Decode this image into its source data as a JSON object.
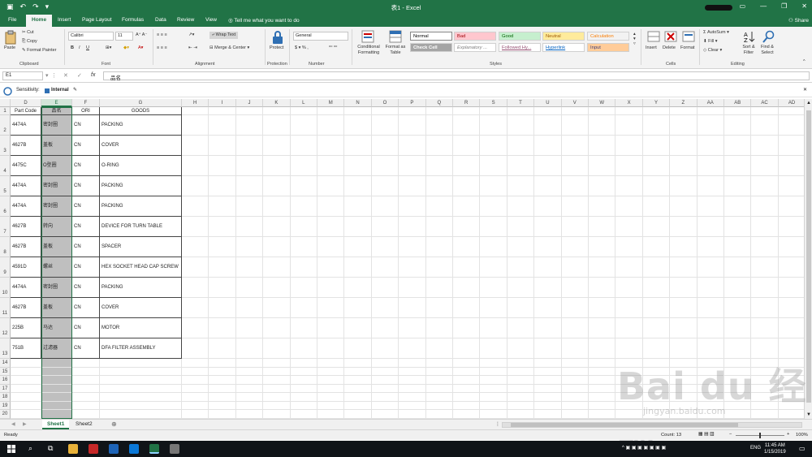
{
  "window": {
    "title": "表1 - Excel"
  },
  "tabs": [
    "File",
    "Home",
    "Insert",
    "Page Layout",
    "Formulas",
    "Data",
    "Review",
    "View"
  ],
  "tellme": "Tell me what you want to do",
  "share": "Share",
  "ribbon": {
    "clipboard": {
      "paste": "Paste",
      "cut": "Cut",
      "copy": "Copy",
      "format_painter": "Format Painter",
      "group": "Clipboard"
    },
    "font": {
      "name": "Calibri",
      "size": "11",
      "group": "Font"
    },
    "alignment": {
      "wrap": "Wrap Text",
      "merge": "Merge & Center",
      "group": "Alignment"
    },
    "protection": {
      "protect": "Protect",
      "group": "Protection"
    },
    "number": {
      "format": "General",
      "group": "Number"
    },
    "styles": {
      "conditional": "Conditional Formatting",
      "format_table": "Format as Table",
      "group": "Styles",
      "cells": [
        {
          "label": "Normal",
          "bg": "#ffffff",
          "fg": "#000000"
        },
        {
          "label": "Bad",
          "bg": "#ffc7ce",
          "fg": "#9c0006"
        },
        {
          "label": "Good",
          "bg": "#c6efce",
          "fg": "#006100"
        },
        {
          "label": "Neutral",
          "bg": "#ffeb9c",
          "fg": "#9c5700"
        },
        {
          "label": "Calculation",
          "bg": "#f2f2f2",
          "fg": "#fa7d00"
        },
        {
          "label": "Check Cell",
          "bg": "#a5a5a5",
          "fg": "#ffffff"
        },
        {
          "label": "Explanatory ...",
          "bg": "#ffffff",
          "fg": "#7f7f7f"
        },
        {
          "label": "Followed Hy...",
          "bg": "#ffffff",
          "fg": "#954f72"
        },
        {
          "label": "Hyperlink",
          "bg": "#ffffff",
          "fg": "#0563c1"
        },
        {
          "label": "Input",
          "bg": "#ffcc99",
          "fg": "#3f3f76"
        }
      ]
    },
    "cells": {
      "insert": "Insert",
      "delete": "Delete",
      "format": "Format",
      "group": "Cells"
    },
    "editing": {
      "autosum": "AutoSum",
      "fill": "Fill",
      "clear": "Clear",
      "sort": "Sort & Filter",
      "find": "Find & Select",
      "group": "Editing"
    }
  },
  "formula_bar": {
    "name_box": "E1",
    "fx": "fx",
    "value": "品名"
  },
  "sensitivity": {
    "label": "Sensitivity:",
    "value": "Internal"
  },
  "columns": [
    "D",
    "E",
    "F",
    "G",
    "H",
    "I",
    "J",
    "K",
    "L",
    "M",
    "N",
    "O",
    "P",
    "Q",
    "R",
    "S",
    "T",
    "U",
    "V",
    "W",
    "X",
    "Y",
    "Z",
    "AA",
    "AB",
    "AC",
    "AD"
  ],
  "headers": [
    "Part Code",
    "品名",
    "ORI",
    "GOODS"
  ],
  "rows": [
    [
      "4474A",
      "密封圈",
      "CN",
      "PACKING"
    ],
    [
      "4627B",
      "盖板",
      "CN",
      "COVER"
    ],
    [
      "4475C",
      "O型圈",
      "CN",
      "O-RING"
    ],
    [
      "4474A",
      "密封圈",
      "CN",
      "PACKING"
    ],
    [
      "4474A",
      "密封圈",
      "CN",
      "PACKING"
    ],
    [
      "4627B",
      "转向",
      "CN",
      "DEVICE FOR TURN TABLE"
    ],
    [
      "4627B",
      "盖板",
      "CN",
      "SPACER"
    ],
    [
      "4591D",
      "螺丝",
      "CN",
      "HEX SOCKET HEAD CAP SCREW"
    ],
    [
      "4474A",
      "密封圈",
      "CN",
      "PACKING"
    ],
    [
      "4627B",
      "盖板",
      "CN",
      "COVER"
    ],
    [
      "225B",
      "马达",
      "CN",
      "MOTOR"
    ],
    [
      "751B",
      "过滤器",
      "CN",
      "DFA FILTER ASSEMBLY"
    ]
  ],
  "row_numbers": [
    "1",
    "2",
    "3",
    "4",
    "5",
    "6",
    "7",
    "8",
    "9",
    "10",
    "11",
    "12",
    "13",
    "14",
    "15",
    "16",
    "17",
    "18",
    "19",
    "20"
  ],
  "sheets": [
    "Sheet1",
    "Sheet2"
  ],
  "status": {
    "left": "Ready",
    "count": "Count: 13",
    "zoom": "100%"
  },
  "taskbar": {
    "time": "11:45 AM",
    "date": "1/15/2019",
    "lang": "ENG"
  },
  "watermark": {
    "text": "Bai du 经验",
    "url": "jingyan.baidu.com"
  }
}
